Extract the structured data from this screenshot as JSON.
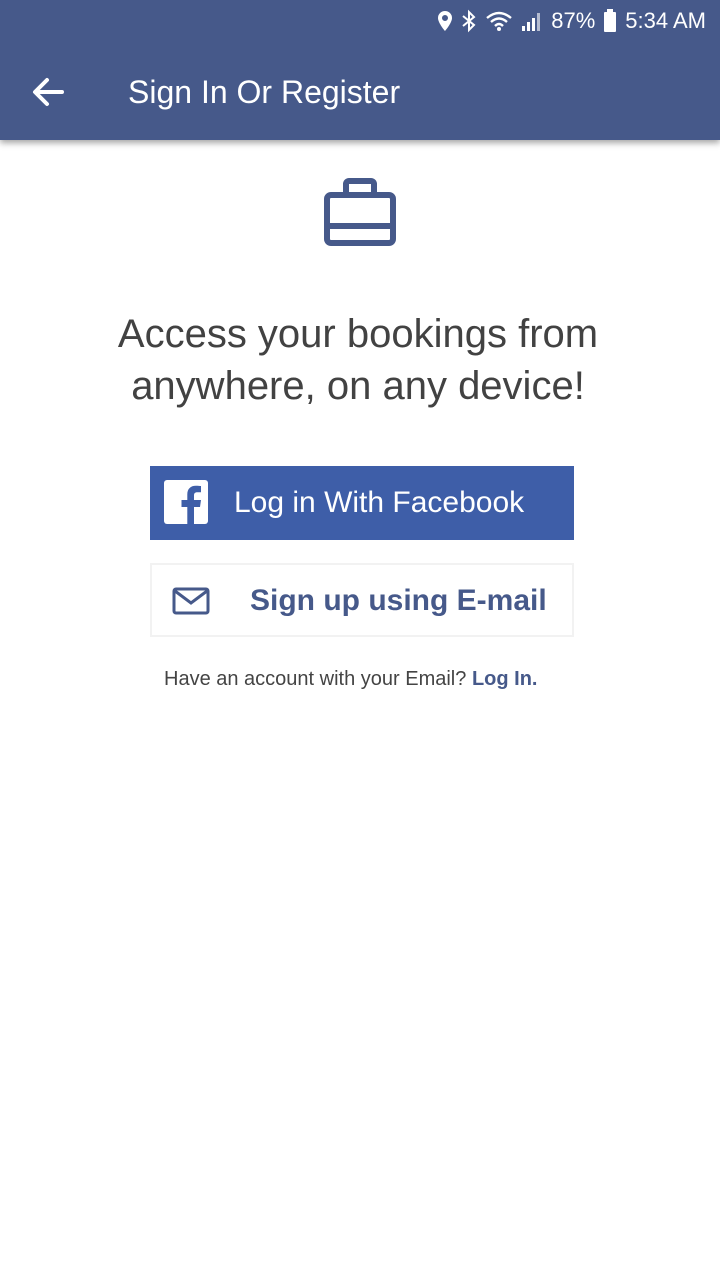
{
  "status_bar": {
    "battery": "87%",
    "time": "5:34 AM",
    "icons": [
      "location-icon",
      "bluetooth-icon",
      "wifi-icon",
      "signal-icon",
      "battery-icon"
    ]
  },
  "app_bar": {
    "title": "Sign In Or Register",
    "back_icon": "arrow-left-icon"
  },
  "main": {
    "hero_icon": "briefcase-icon",
    "headline_line1": "Access your bookings from",
    "headline_line2": "anywhere, on any device!",
    "facebook_button": {
      "label": "Log in With Facebook",
      "icon": "facebook-icon"
    },
    "email_button": {
      "label": "Sign up using E-mail",
      "icon": "mail-icon"
    },
    "login_prompt": "Have an account with your Email?",
    "login_link": "Log In."
  },
  "colors": {
    "primary": "#46598a",
    "facebook": "#3e5ea8",
    "text": "#424242",
    "background": "#ffffff"
  }
}
